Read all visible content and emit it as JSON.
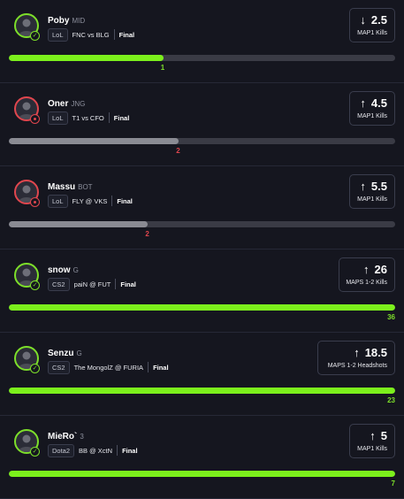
{
  "colors": {
    "background": "#15161f",
    "win": "#7ddf2a",
    "loss": "#e0464e",
    "bar_win": "#7cf01c",
    "bar_loss": "#8a8b93",
    "track": "#3a3b45"
  },
  "picks": [
    {
      "player": "Poby",
      "position": "MID",
      "game": "LoL",
      "match": "FNC vs BLG",
      "status": "Final",
      "direction": "down",
      "arrow": "↓",
      "line": "2.5",
      "stat": "MAP1 Kills",
      "actual": "1",
      "progress": 0.4,
      "outcome": "win",
      "avatar_icon": "player-silhouette-icon"
    },
    {
      "player": "Oner",
      "position": "JNG",
      "game": "LoL",
      "match": "T1 vs CFO",
      "status": "Final",
      "direction": "up",
      "arrow": "↑",
      "line": "4.5",
      "stat": "MAP1 Kills",
      "actual": "2",
      "progress": 0.44,
      "outcome": "loss",
      "avatar_icon": "player-silhouette-icon"
    },
    {
      "player": "Massu",
      "position": "BOT",
      "game": "LoL",
      "match": "FLY @ VKS",
      "status": "Final",
      "direction": "up",
      "arrow": "↑",
      "line": "5.5",
      "stat": "MAP1 Kills",
      "actual": "2",
      "progress": 0.36,
      "outcome": "loss",
      "avatar_icon": "player-silhouette-icon"
    },
    {
      "player": "snow",
      "position": "G",
      "game": "CS2",
      "match": "paiN @ FUT",
      "status": "Final",
      "direction": "up",
      "arrow": "↑",
      "line": "26",
      "stat": "MAPS 1-2 Kills",
      "actual": "36",
      "progress": 1.0,
      "outcome": "win",
      "avatar_icon": "player-silhouette-icon"
    },
    {
      "player": "Senzu",
      "position": "G",
      "game": "CS2",
      "match": "The MongolZ @ FURIA",
      "status": "Final",
      "direction": "up",
      "arrow": "↑",
      "line": "18.5",
      "stat": "MAPS 1-2 Headshots",
      "actual": "23",
      "progress": 1.0,
      "outcome": "win",
      "avatar_icon": "player-silhouette-icon"
    },
    {
      "player": "MieRo`",
      "position": "3",
      "game": "Dota2",
      "match": "BB @ XctN",
      "status": "Final",
      "direction": "up",
      "arrow": "↑",
      "line": "5",
      "stat": "MAP1 Kills",
      "actual": "7",
      "progress": 1.0,
      "outcome": "win",
      "avatar_icon": "player-silhouette-icon"
    }
  ]
}
